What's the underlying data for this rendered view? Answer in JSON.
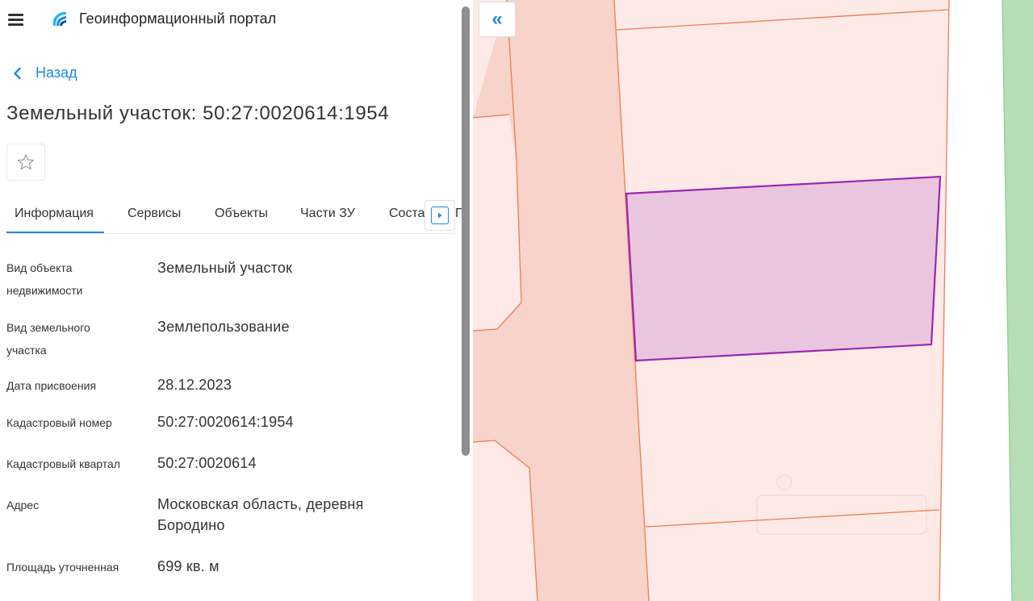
{
  "app": {
    "title": "Геоинформационный портал"
  },
  "nav": {
    "back_label": "Назад"
  },
  "page": {
    "title": "Земельный участок: 50:27:0020614:1954"
  },
  "tabs": [
    {
      "label": "Информация",
      "active": true
    },
    {
      "label": "Сервисы"
    },
    {
      "label": "Объекты"
    },
    {
      "label": "Части ЗУ"
    },
    {
      "label": "Соста"
    }
  ],
  "tabs_overflow_peek": "Г",
  "info": [
    {
      "label": "Вид объекта недвижимости",
      "value": "Земельный участок"
    },
    {
      "label": "Вид земельного участка",
      "value": "Землепользование"
    },
    {
      "label": "Дата присвоения",
      "value": "28.12.2023"
    },
    {
      "label": "Кадастровый номер",
      "value": "50:27:0020614:1954"
    },
    {
      "label": "Кадастровый квартал",
      "value": "50:27:0020614"
    },
    {
      "label": "Адрес",
      "value": "Московская область, деревня Бородино"
    },
    {
      "label": "Площадь уточненная",
      "value": "699 кв. м"
    }
  ],
  "icons": {
    "menu": "menu-icon",
    "logo": "portal-logo",
    "back": "chevron-left-icon",
    "favorite": "star-outline-icon",
    "tabs_next": "caret-right-icon",
    "collapse": "double-chevron-left-icon"
  },
  "colors": {
    "accent": "#1e88e5",
    "parcel_fill": "#fdeae6",
    "parcel_border": "#f07a55",
    "road_fill": "#f8d3c9",
    "selected_fill": "#eac5df",
    "selected_border": "#9c27b0",
    "green_zone": "#b5ddb6"
  }
}
